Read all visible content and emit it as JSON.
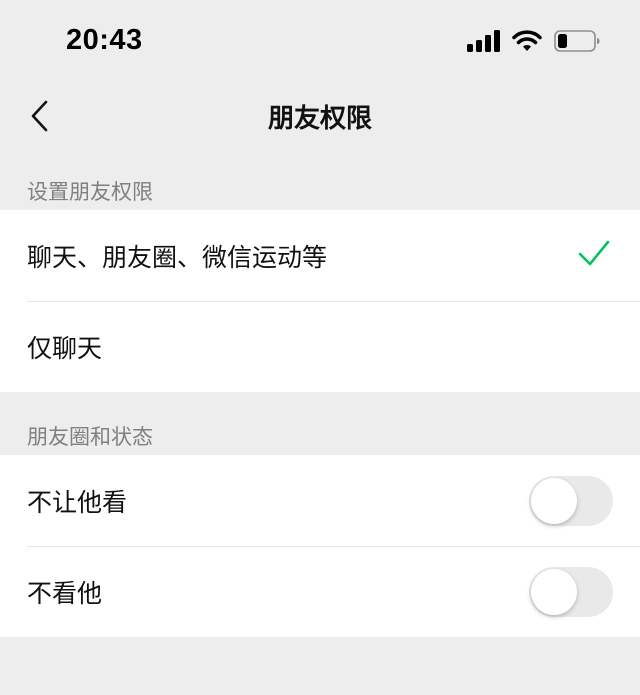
{
  "status_bar": {
    "time": "20:43",
    "icons": [
      "signal-icon",
      "wifi-icon",
      "battery-icon"
    ]
  },
  "nav": {
    "title": "朋友权限",
    "back_icon": "chevron-left-icon"
  },
  "sections": [
    {
      "header": "设置朋友权限",
      "options": [
        {
          "label": "聊天、朋友圈、微信运动等",
          "selected": true
        },
        {
          "label": "仅聊天",
          "selected": false
        }
      ]
    },
    {
      "header": "朋友圈和状态",
      "toggles": [
        {
          "label": "不让他看",
          "on": false
        },
        {
          "label": "不看他",
          "on": false
        }
      ]
    }
  ],
  "colors": {
    "background": "#ededed",
    "accent_green": "#07c160",
    "toggle_off": "#e9e9ea"
  }
}
